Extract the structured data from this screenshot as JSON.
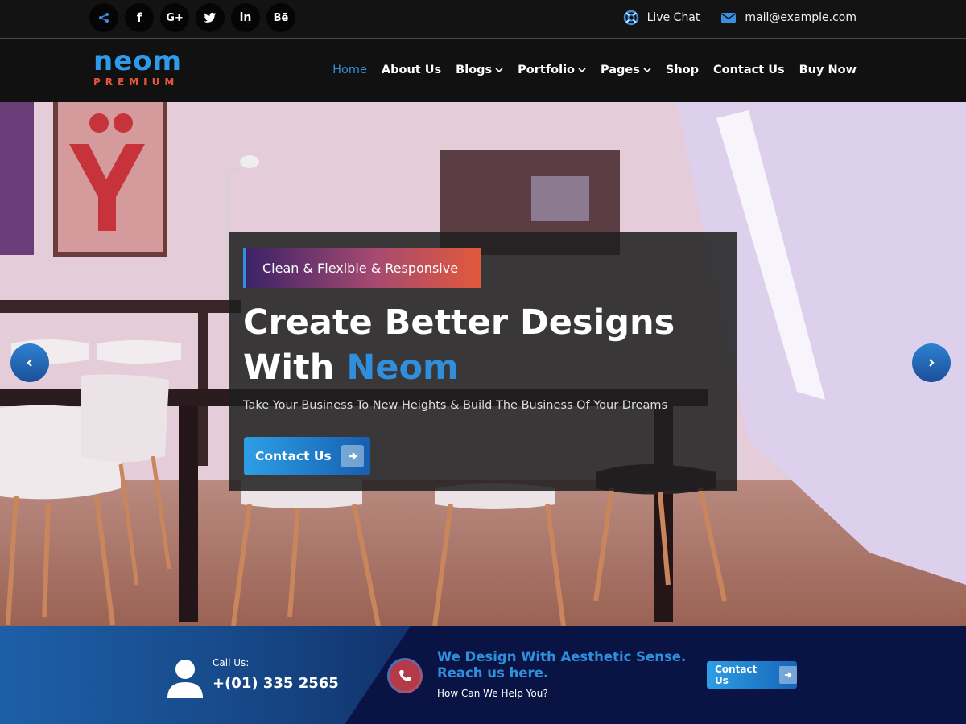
{
  "topbar": {
    "social_icons": [
      "share-icon",
      "facebook-icon",
      "google-plus-icon",
      "twitter-icon",
      "linkedin-icon",
      "behance-icon"
    ],
    "social_glyphs": [
      "",
      "f",
      "G+",
      "",
      "in",
      "Bē"
    ],
    "live_chat_label": "Live Chat",
    "email_label": "mail@example.com"
  },
  "logo": {
    "main": "neom",
    "sub": "PREMIUM"
  },
  "nav": {
    "items": [
      {
        "label": "Home",
        "active": true,
        "dropdown": false
      },
      {
        "label": "About Us",
        "dropdown": false
      },
      {
        "label": "Blogs",
        "dropdown": true
      },
      {
        "label": "Portfolio",
        "dropdown": true
      },
      {
        "label": "Pages",
        "dropdown": true
      },
      {
        "label": "Shop",
        "dropdown": false
      },
      {
        "label": "Contact Us",
        "dropdown": false
      },
      {
        "label": "Buy Now",
        "dropdown": false
      }
    ]
  },
  "hero": {
    "tagline": "Clean & Flexible & Responsive",
    "title_line1": "Create Better Designs",
    "title_line2_prefix": "With ",
    "title_line2_accent": "Neom",
    "subtitle": "Take Your Business To New Heights & Build The Business Of Your Dreams",
    "cta_label": "Contact Us"
  },
  "band": {
    "call_label": "Call Us:",
    "call_number": "+(01) 335 2565",
    "heading_line1": "We Design With Aesthetic Sense.",
    "heading_line2": "Reach us here.",
    "subtext": "How Can We Help You?",
    "cta_label": "Contact Us"
  },
  "colors": {
    "accent": "#2f8fdc",
    "brand_orange": "#e5553d",
    "topbar": "#131313",
    "band": "#0a1444"
  }
}
